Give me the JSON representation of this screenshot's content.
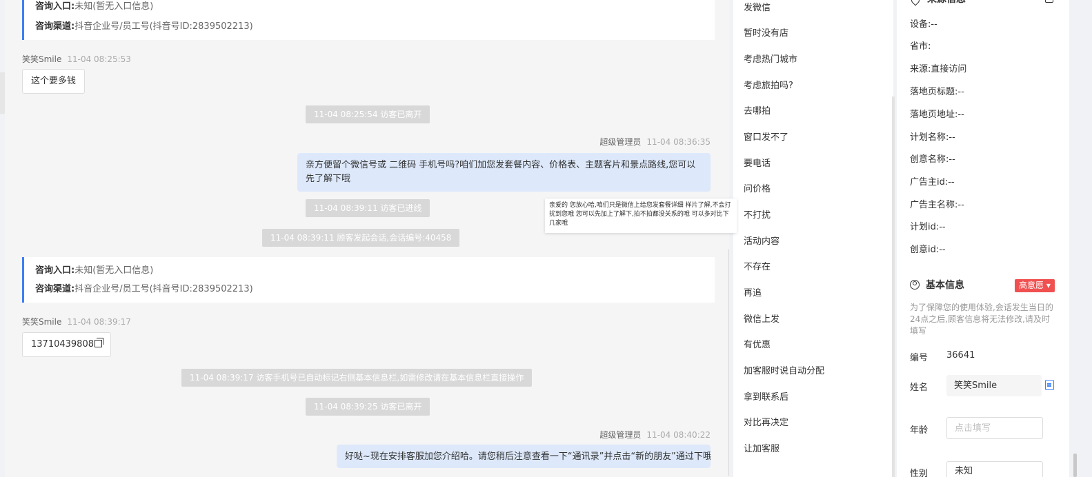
{
  "chat": {
    "card1": {
      "entry_label": "咨询入口:",
      "entry_value": "未知(暂无入口信息)",
      "channel_label": "咨询渠道:",
      "channel_value": "抖音企业号/员工号(抖音号ID:2839502213)"
    },
    "msg1": {
      "sender": "笑笑Smile",
      "time": "11-04 08:25:53",
      "text": "这个要多钱"
    },
    "sys1": "11-04 08:25:54 访客已离开",
    "msg2": {
      "sender": "超级管理员",
      "time": "11-04 08:36:35",
      "text": "亲方便留个微信号或 二维码 手机号吗?咱们加您发套餐内容、价格表、主题客片和景点路线,您可以先了解下哦"
    },
    "sys2": "11-04 08:39:11 访客已进线",
    "sys3": "11-04 08:39:11 顾客发起会话,会话编号:40458",
    "card2": {
      "entry_label": "咨询入口:",
      "entry_value": "未知(暂无入口信息)",
      "channel_label": "咨询渠道:",
      "channel_value": "抖音企业号/员工号(抖音号ID:2839502213)"
    },
    "msg3": {
      "sender": "笑笑Smile",
      "time": "11-04 08:39:17",
      "text": "13710439808"
    },
    "sys4": "11-04 08:39:17 访客手机号已自动标记右侧基本信息栏,如需修改请在基本信息栏直接操作",
    "sys5": "11-04 08:39:25 访客已离开",
    "msg4": {
      "sender": "超级管理员",
      "time": "11-04 08:40:22",
      "text": "好哒~现在安排客服加您介绍哈。请您稍后注意查看一下“通讯录”并点击“新的朋友”通过下哦"
    }
  },
  "tooltip": "亲爱的 您放心哈,咱们只是微信上给您发套餐详细 样片了解,不会打扰到您哦 您可以先加上了解下,拍不拍都没关系的哦 可以多对比下几家哦",
  "quick_replies": [
    "发微信",
    "暂时没有店",
    "考虑热门城市",
    "考虑旅拍吗?",
    "去哪拍",
    "窗口发不了",
    "要电话",
    "问价格",
    "不打扰",
    "活动内容",
    "不存在",
    "再追",
    "微信上发",
    "有优惠",
    "加客服时说自动分配",
    "拿到联系后",
    "对比再决定",
    "让加客服"
  ],
  "source_info": {
    "title": "来源信息",
    "rows": [
      "设备:--",
      "省市:",
      "来源:直接访问",
      "落地页标题:--",
      "落地页地址:--",
      "计划名称:--",
      "创意名称:--",
      "广告主id:--",
      "广告主名称:--",
      "计划id:--",
      "创意id:--"
    ]
  },
  "basic_info": {
    "title": "基本信息",
    "badge": "高意愿 ▾",
    "hint": "为了保障您的使用体验,会话发生当日的24点之后,顾客信息将无法修改,请及时填写",
    "id_label": "编号",
    "id_value": "36641",
    "name_label": "姓名",
    "name_value": "笑笑Smile",
    "age_label": "年龄",
    "age_placeholder": "点击填写",
    "gender_label": "性别",
    "gender_value": "未知"
  },
  "colors": {
    "accent": "#3d7ff5",
    "badge": "#f05050",
    "bubble_out": "#dde9fb"
  }
}
